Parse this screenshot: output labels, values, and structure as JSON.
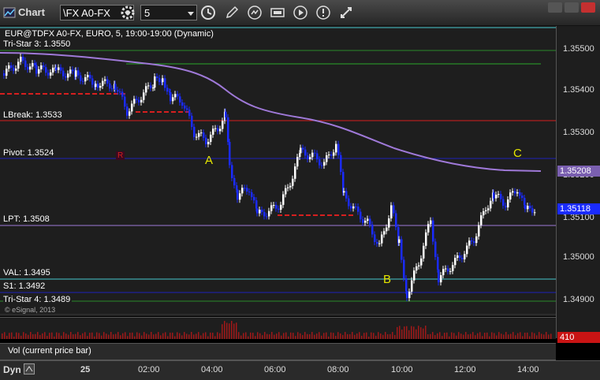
{
  "window": {
    "title": "Chart",
    "symbol_value": "\\FX A0-FX",
    "interval_value": "5"
  },
  "chart": {
    "header": "EUR@TDFX A0-FX, EURO, 5, 19:00-19:00 (Dynamic)",
    "copyright": "© eSignal, 2013",
    "level_labels": {
      "tristar3": "Tri-Star 3: 1.3550",
      "lbreak": "LBreak: 1.3533",
      "pivot": "Pivot: 1.3524",
      "lpt": "LPT: 1.3508",
      "val": "VAL: 1.3495",
      "s1": "S1: 1.3492",
      "tristar4": "Tri-Star 4: 1.3489"
    },
    "annotations": {
      "a": "A",
      "b": "B",
      "c": "C",
      "r_marker": "R"
    },
    "price_ticks": [
      "1.35500",
      "1.35400",
      "1.35300",
      "1.35200",
      "1.35100",
      "1.35000",
      "1.34900"
    ],
    "price_tags": {
      "ma": "1.35208",
      "last": "1.35118",
      "volume": "410"
    },
    "time_ticks": [
      "25",
      "02:00",
      "04:00",
      "06:00",
      "08:00",
      "10:00",
      "12:00",
      "14:00"
    ],
    "volume_label": "Vol (current price bar)",
    "dyn_label": "Dyn",
    "colors": {
      "up": "#ffffff",
      "down": "#1a2bff",
      "ma": "#9f79d8",
      "red_level": "#d61f1f",
      "pivot": "#1e22b8",
      "cyan": "#45c8cf",
      "green": "#2a8a2a",
      "yellow": "#e6e600"
    }
  }
}
